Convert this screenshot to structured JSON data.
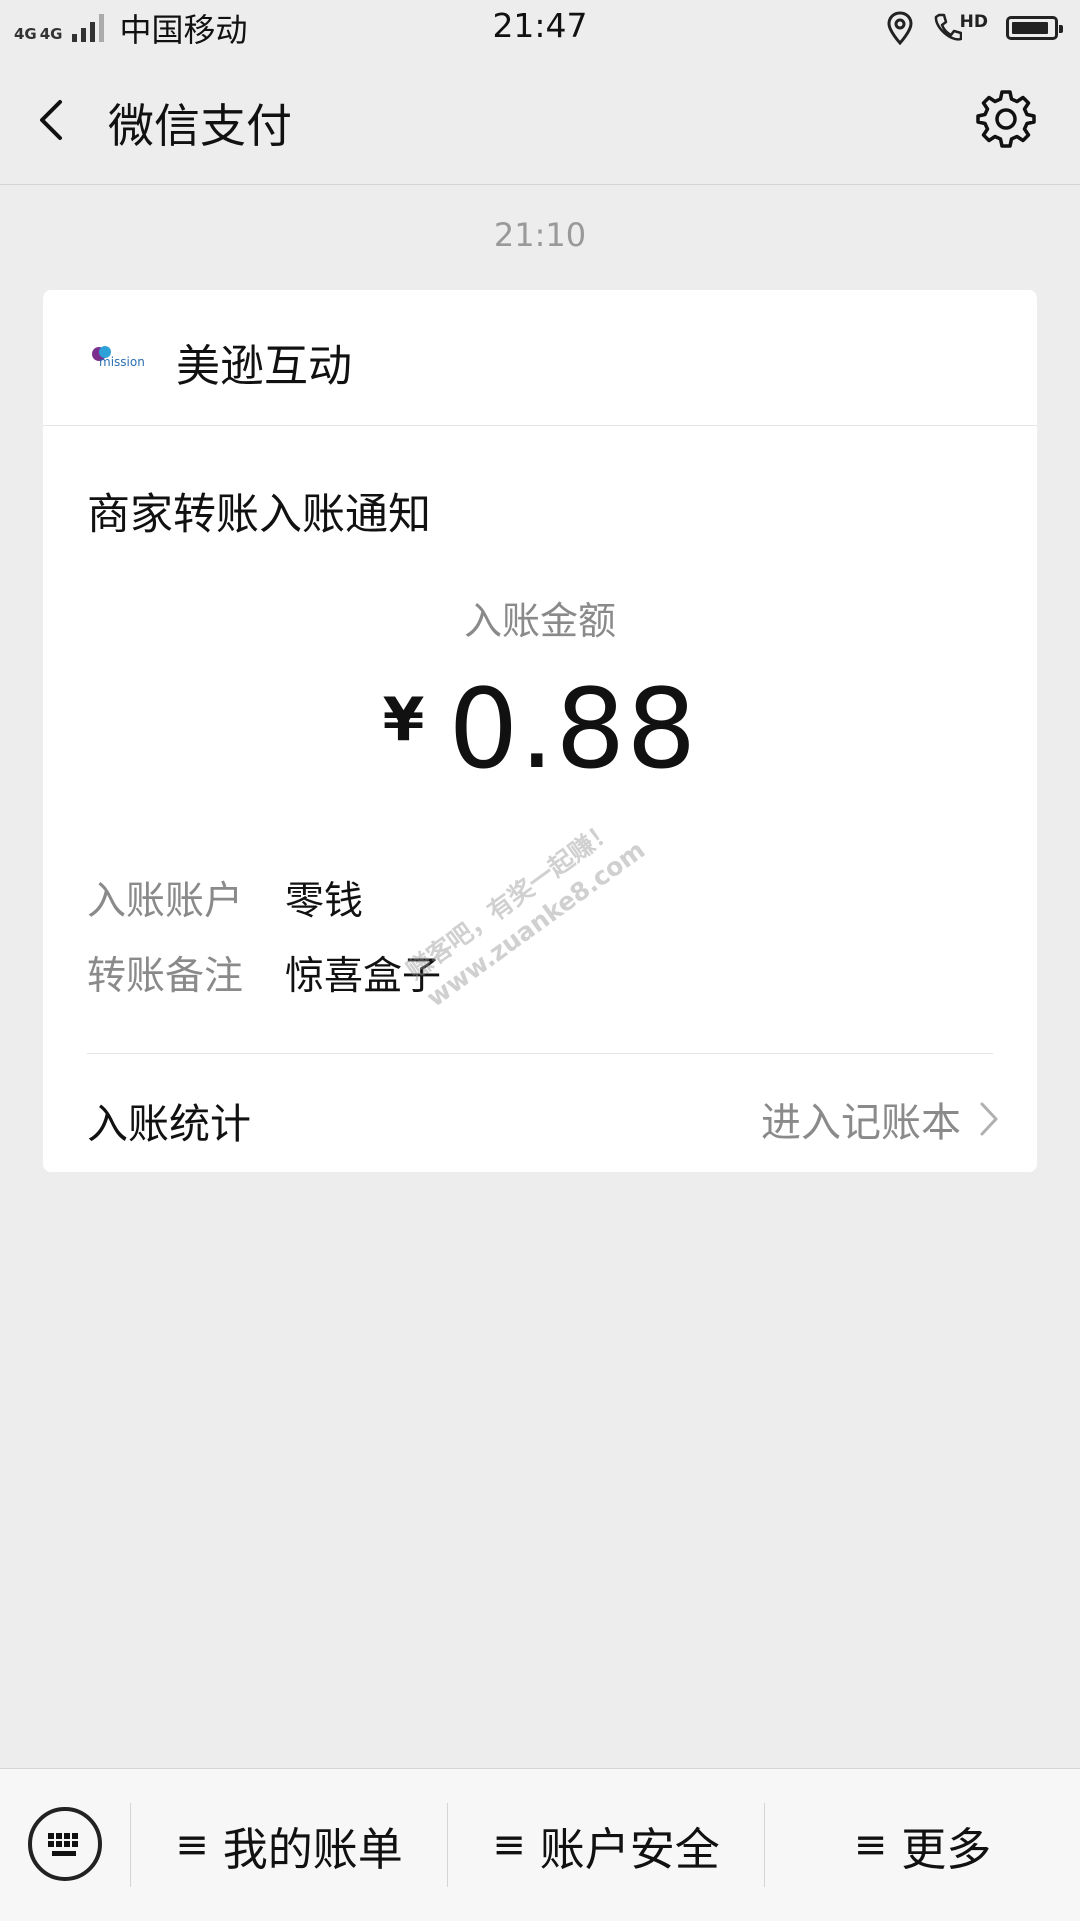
{
  "status_bar": {
    "signal": [
      "4G",
      "4G"
    ],
    "carrier": "中国移动",
    "time": "21:47",
    "hd_label": "HD",
    "battery_level": 0.9
  },
  "header": {
    "title": "微信支付"
  },
  "message": {
    "timestamp": "21:10",
    "merchant_name": "美逊互动",
    "logo_text": "mission",
    "notice_title": "商家转账入账通知",
    "amount_label": "入账金额",
    "currency_symbol": "¥",
    "amount": "0.88",
    "details": [
      {
        "key": "入账账户",
        "value": "零钱"
      },
      {
        "key": "转账备注",
        "value": "惊喜盒子"
      }
    ],
    "stats_label": "入账统计",
    "ledger_link": "进入记账本"
  },
  "watermark": {
    "line1": "赚客吧，有奖一起赚！",
    "line2": "www.zuanke8.com"
  },
  "bottom_menu": [
    "我的账单",
    "账户安全",
    "更多"
  ],
  "colors": {
    "background": "#ededed",
    "card": "#ffffff",
    "secondary_text": "#8a8a8a"
  }
}
